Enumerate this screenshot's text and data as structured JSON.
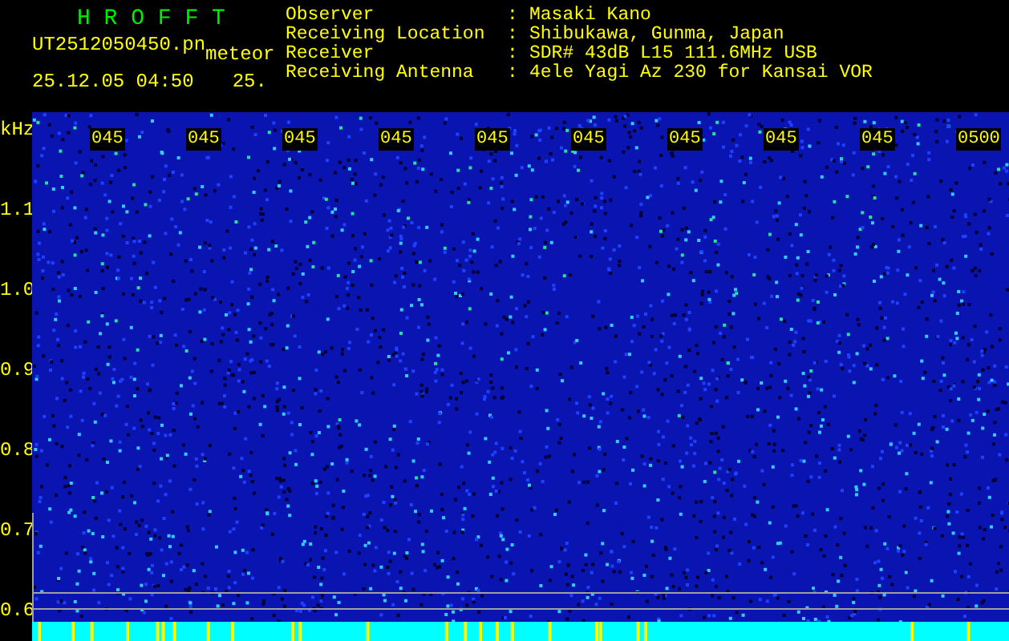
{
  "app_title": "H R O F F T",
  "file_name": "UT2512050450.pn",
  "tag": "meteor",
  "timestamp": "25.12.05 04:50",
  "timestamp_2": "25.",
  "info": [
    {
      "label": "Observer",
      "separator": ":",
      "value": "Masaki Kano"
    },
    {
      "label": "Receiving Location",
      "separator": ":",
      "value": "Shibukawa, Gunma, Japan"
    },
    {
      "label": "Receiver",
      "separator": ":",
      "value": "SDR# 43dB L15 111.6MHz USB"
    },
    {
      "label": "Receiving Antenna",
      "separator": ":",
      "value": "4ele Yagi Az 230 for Kansai VOR"
    }
  ],
  "axis_unit": "kHz",
  "frequency_labels": [
    "1.1",
    "1.0",
    "0.9",
    "0.8",
    "0.7",
    "0.6"
  ],
  "time_labels": [
    "045",
    "045",
    "045",
    "045",
    "045",
    "045",
    "045",
    "045",
    "045",
    "0500"
  ]
}
